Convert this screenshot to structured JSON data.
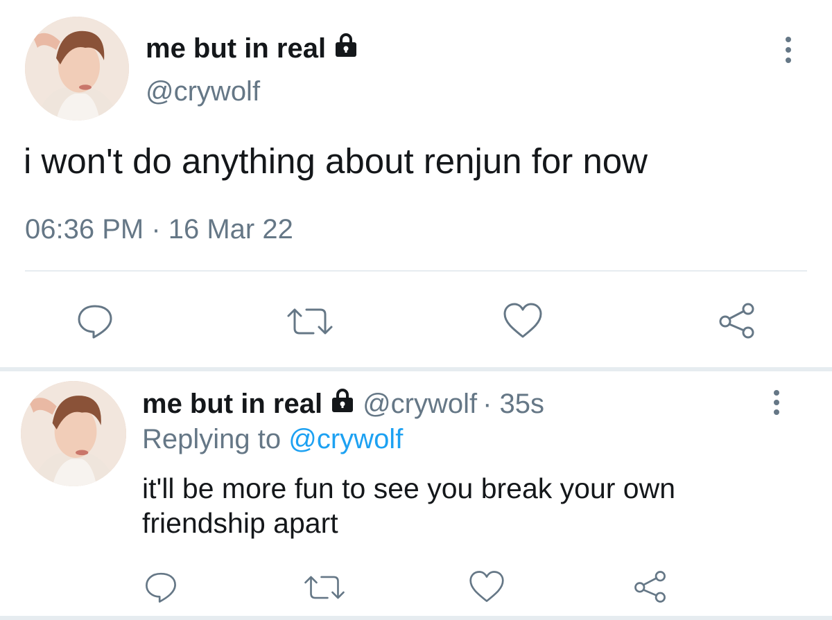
{
  "main_tweet": {
    "display_name": "me but in real",
    "handle": "@crywolf",
    "text": "i won't do anything about renjun for now",
    "timestamp": "06:36 PM · 16 Mar 22",
    "icons": [
      "lock-icon",
      "more-vertical-icon"
    ],
    "actions": [
      "reply-icon",
      "retweet-icon",
      "like-icon",
      "share-icon"
    ]
  },
  "reply_tweet": {
    "display_name": "me but in real",
    "handle": "@crywolf",
    "time_ago": "· 35s",
    "replying_prefix": "Replying to",
    "replying_handle": "@crywolf",
    "text_line1": "it'll be more fun to see you break your own",
    "text_line2": "friendship apart",
    "icons": [
      "lock-icon",
      "more-vertical-icon"
    ],
    "actions": [
      "reply-icon",
      "retweet-icon",
      "like-icon",
      "share-icon"
    ]
  },
  "colors": {
    "text": "#14171a",
    "muted": "#657786",
    "link": "#1da1f2",
    "divider": "#e6ecf0"
  }
}
